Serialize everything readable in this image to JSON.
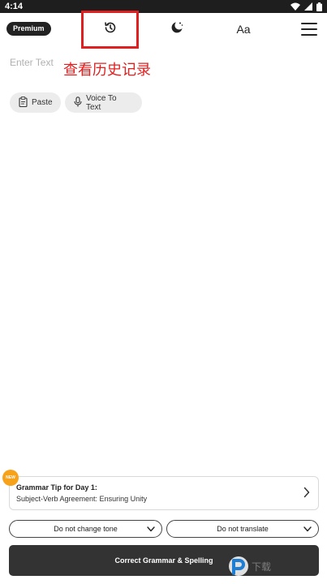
{
  "status_bar": {
    "time": "4:14"
  },
  "header": {
    "premium_label": "Premium",
    "font_button_label": "Aa"
  },
  "editor": {
    "placeholder": "Enter Text",
    "annotation": "查看历史记录"
  },
  "actions": {
    "paste_label": "Paste",
    "voice_label": "Voice To Text"
  },
  "tip": {
    "badge": "NEW",
    "title": "Grammar Tip for Day 1:",
    "subtitle": "Subject-Verb Agreement: Ensuring Unity"
  },
  "options": {
    "tone_selected": "Do not change tone",
    "translate_selected": "Do not translate"
  },
  "primary_action": {
    "label": "Correct Grammar & Spelling"
  },
  "watermark": {
    "text": "下载"
  },
  "colors": {
    "annotation_red": "#e02020",
    "button_dark": "#333333",
    "new_badge_orange": "#f7a21b",
    "watermark_blue": "#1a8cf0"
  },
  "icons": [
    "wifi-icon",
    "signal-icon",
    "battery-icon",
    "history-icon",
    "moon-stars-icon",
    "menu-icon",
    "paste-icon",
    "microphone-icon",
    "chevron-right-icon",
    "chevron-down-icon"
  ]
}
